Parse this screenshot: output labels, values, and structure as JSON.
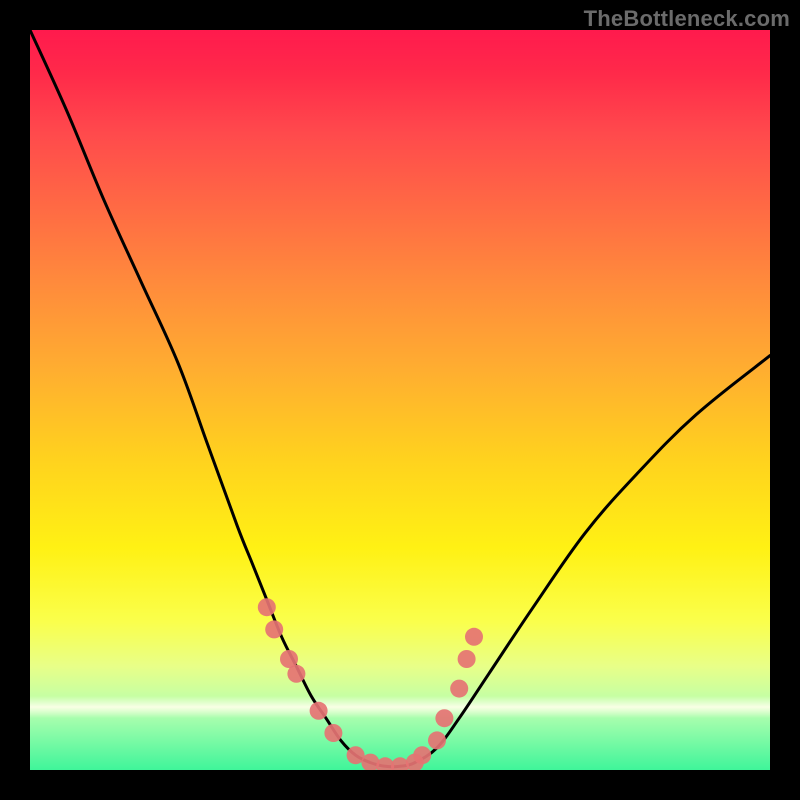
{
  "watermark": "TheBottleneck.com",
  "chart_data": {
    "type": "line",
    "title": "",
    "xlabel": "",
    "ylabel": "",
    "xlim": [
      0,
      100
    ],
    "ylim": [
      0,
      100
    ],
    "series": [
      {
        "name": "curve",
        "x": [
          0,
          5,
          10,
          15,
          20,
          24,
          28,
          30,
          32,
          34,
          36,
          38,
          40,
          42,
          44,
          46,
          48,
          50,
          52,
          55,
          58,
          62,
          68,
          75,
          82,
          90,
          100
        ],
        "values": [
          100,
          89,
          77,
          66,
          55,
          44,
          33,
          28,
          23,
          18,
          14,
          10,
          7,
          4,
          2,
          1,
          0.5,
          0.5,
          1,
          3,
          7,
          13,
          22,
          32,
          40,
          48,
          56
        ]
      }
    ],
    "markers": {
      "name": "points",
      "x": [
        32,
        33,
        35,
        36,
        39,
        41,
        44,
        46,
        48,
        50,
        52,
        53,
        55,
        56,
        58,
        59,
        60
      ],
      "values": [
        22,
        19,
        15,
        13,
        8,
        5,
        2,
        1,
        0.5,
        0.5,
        1,
        2,
        4,
        7,
        11,
        15,
        18
      ],
      "color": "#e57373",
      "radius": 9
    },
    "colors": {
      "curve_stroke": "#000000",
      "gradient_top": "#ff1a4d",
      "gradient_bottom": "#3ff59a",
      "marker_fill": "#e57373",
      "background_frame": "#000000"
    }
  }
}
